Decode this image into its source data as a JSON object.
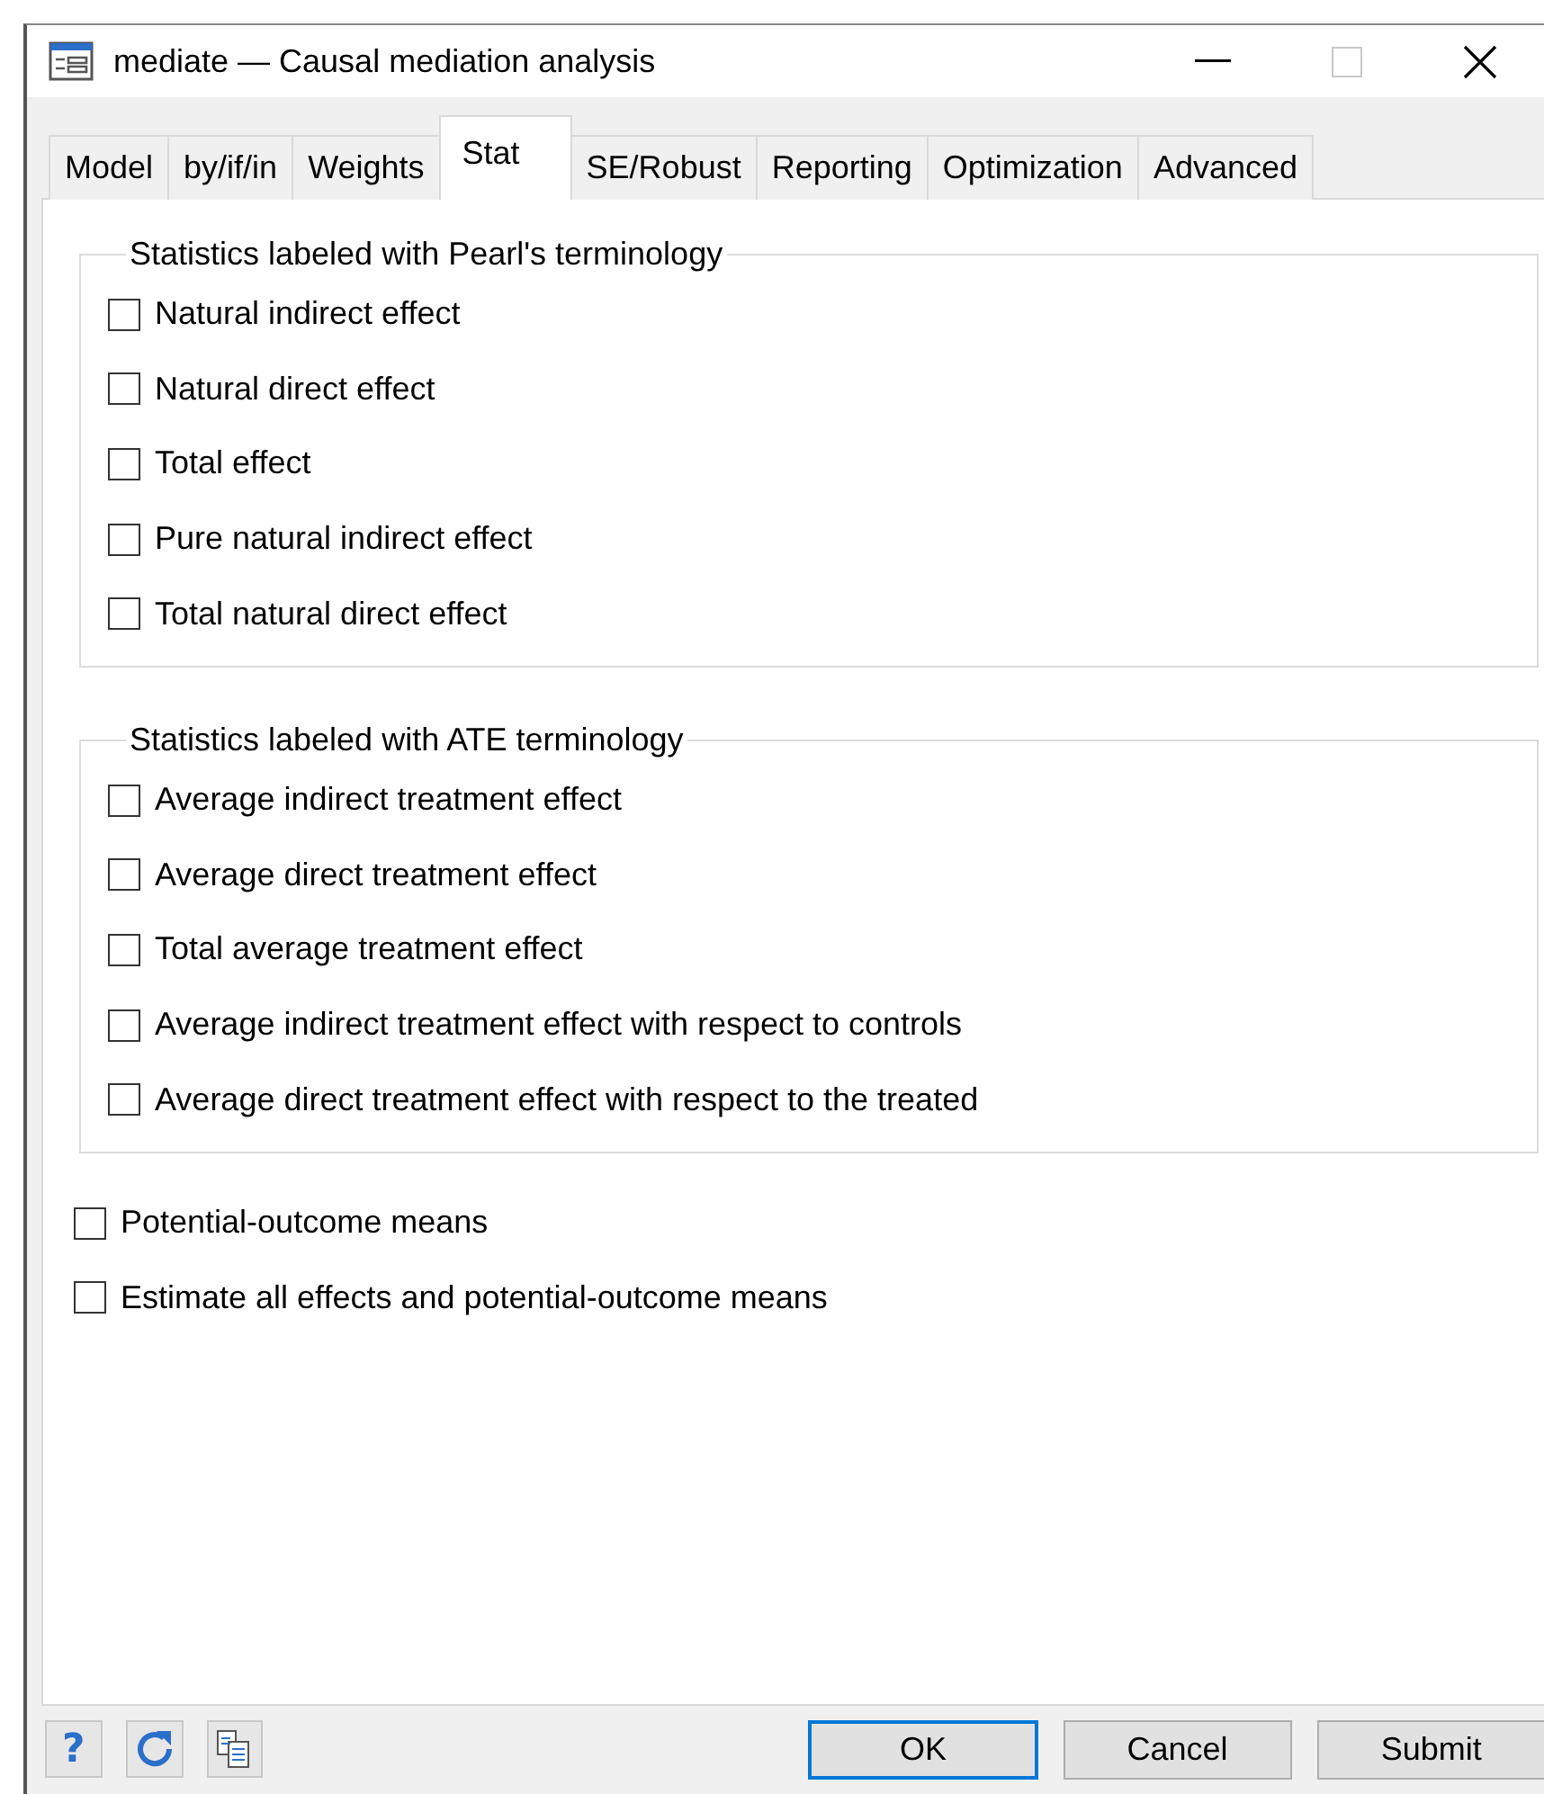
{
  "window": {
    "title": "mediate — Causal mediation analysis"
  },
  "tabs": [
    {
      "label": "Model",
      "selected": false
    },
    {
      "label": "by/if/in",
      "selected": false
    },
    {
      "label": "Weights",
      "selected": false
    },
    {
      "label": "Stat",
      "selected": true
    },
    {
      "label": "SE/Robust",
      "selected": false
    },
    {
      "label": "Reporting",
      "selected": false
    },
    {
      "label": "Optimization",
      "selected": false
    },
    {
      "label": "Advanced",
      "selected": false
    }
  ],
  "groups": [
    {
      "legend": "Statistics labeled with Pearl's terminology",
      "options": [
        {
          "label": "Natural indirect effect",
          "checked": false
        },
        {
          "label": "Natural direct effect",
          "checked": false
        },
        {
          "label": "Total effect",
          "checked": false
        },
        {
          "label": "Pure natural indirect effect",
          "checked": false
        },
        {
          "label": "Total natural direct effect",
          "checked": false
        }
      ]
    },
    {
      "legend": "Statistics labeled with ATE terminology",
      "options": [
        {
          "label": "Average indirect treatment effect",
          "checked": false
        },
        {
          "label": "Average direct treatment effect",
          "checked": false
        },
        {
          "label": "Total average treatment effect",
          "checked": false
        },
        {
          "label": "Average indirect treatment effect with respect to controls",
          "checked": false
        },
        {
          "label": "Average direct treatment effect with respect to the treated",
          "checked": false
        }
      ]
    }
  ],
  "options": [
    {
      "label": "Potential-outcome means",
      "checked": false
    },
    {
      "label": "Estimate all effects and potential-outcome means",
      "checked": false
    }
  ],
  "footer": {
    "help": "?",
    "buttons": [
      {
        "label": "OK",
        "default": true
      },
      {
        "label": "Cancel",
        "default": false
      },
      {
        "label": "Submit",
        "default": false
      }
    ]
  }
}
